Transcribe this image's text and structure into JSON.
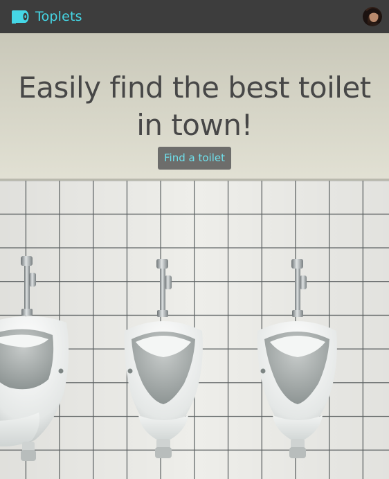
{
  "navbar": {
    "brand_name": "Toplets",
    "brand_icon": "toilet-paper-icon",
    "avatar": "user-avatar"
  },
  "hero": {
    "title_line1": "Easily find the best toilet",
    "title_line2": "in town!",
    "cta_label": "Find a toilet",
    "background": "bathroom-urinals-photo"
  },
  "colors": {
    "navbar_bg": "#3d3d3d",
    "brand": "#45d7e6",
    "title_text": "#474747",
    "cta_bg": "#6d6d6b",
    "cta_text": "#6fe0ec"
  }
}
